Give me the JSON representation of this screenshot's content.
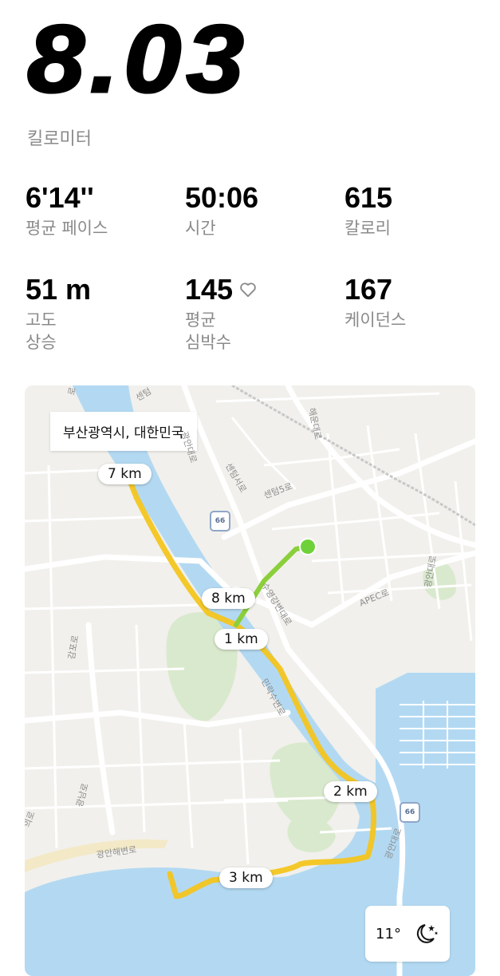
{
  "summary": {
    "distance": "8.03",
    "distance_unit": "킬로미터"
  },
  "stats": [
    {
      "value": "6'14''",
      "label": "평균 페이스"
    },
    {
      "value": "50:06",
      "label": "시간"
    },
    {
      "value": "615",
      "label": "칼로리"
    },
    {
      "value": "51 m",
      "label": "고도\n상승"
    },
    {
      "value": "145",
      "label": "평균\n심박수"
    },
    {
      "value": "167",
      "label": "케이던스"
    }
  ],
  "map": {
    "location": "부산광역시, 대한민국",
    "km_markers": [
      "7 km",
      "8 km",
      "1 km",
      "2 km",
      "3 km"
    ],
    "roads": {
      "gwangan_daero": "광안대로",
      "sentum_seoro": "센텀서로",
      "sentum_5ro": "센텀5로",
      "suyeonggang_byeonro": "수영강변대로",
      "apec_ro": "APEC로",
      "haeundae_ro": "해운대로",
      "millak_bando": "민락수변로",
      "gwangnam_ro": "광남로",
      "gwangan_haebyeon_ro": "광안해변로",
      "sentum_top": "센텀",
      "gwangan_daero_2": "광안대로",
      "left_road": "의로",
      "gajo_ro": "감포로",
      "top_left": "로",
      "apec_vertical": "광안대로"
    },
    "shield_number": "66",
    "weather": {
      "temperature": "11°",
      "icon": "moon-stars-icon"
    },
    "colors": {
      "water": "#b3d9f2",
      "land": "#f1f0ec",
      "park": "#d9e9cd",
      "route": "#f3c51f",
      "start": "#6fd13a",
      "end": "#e53935"
    }
  }
}
